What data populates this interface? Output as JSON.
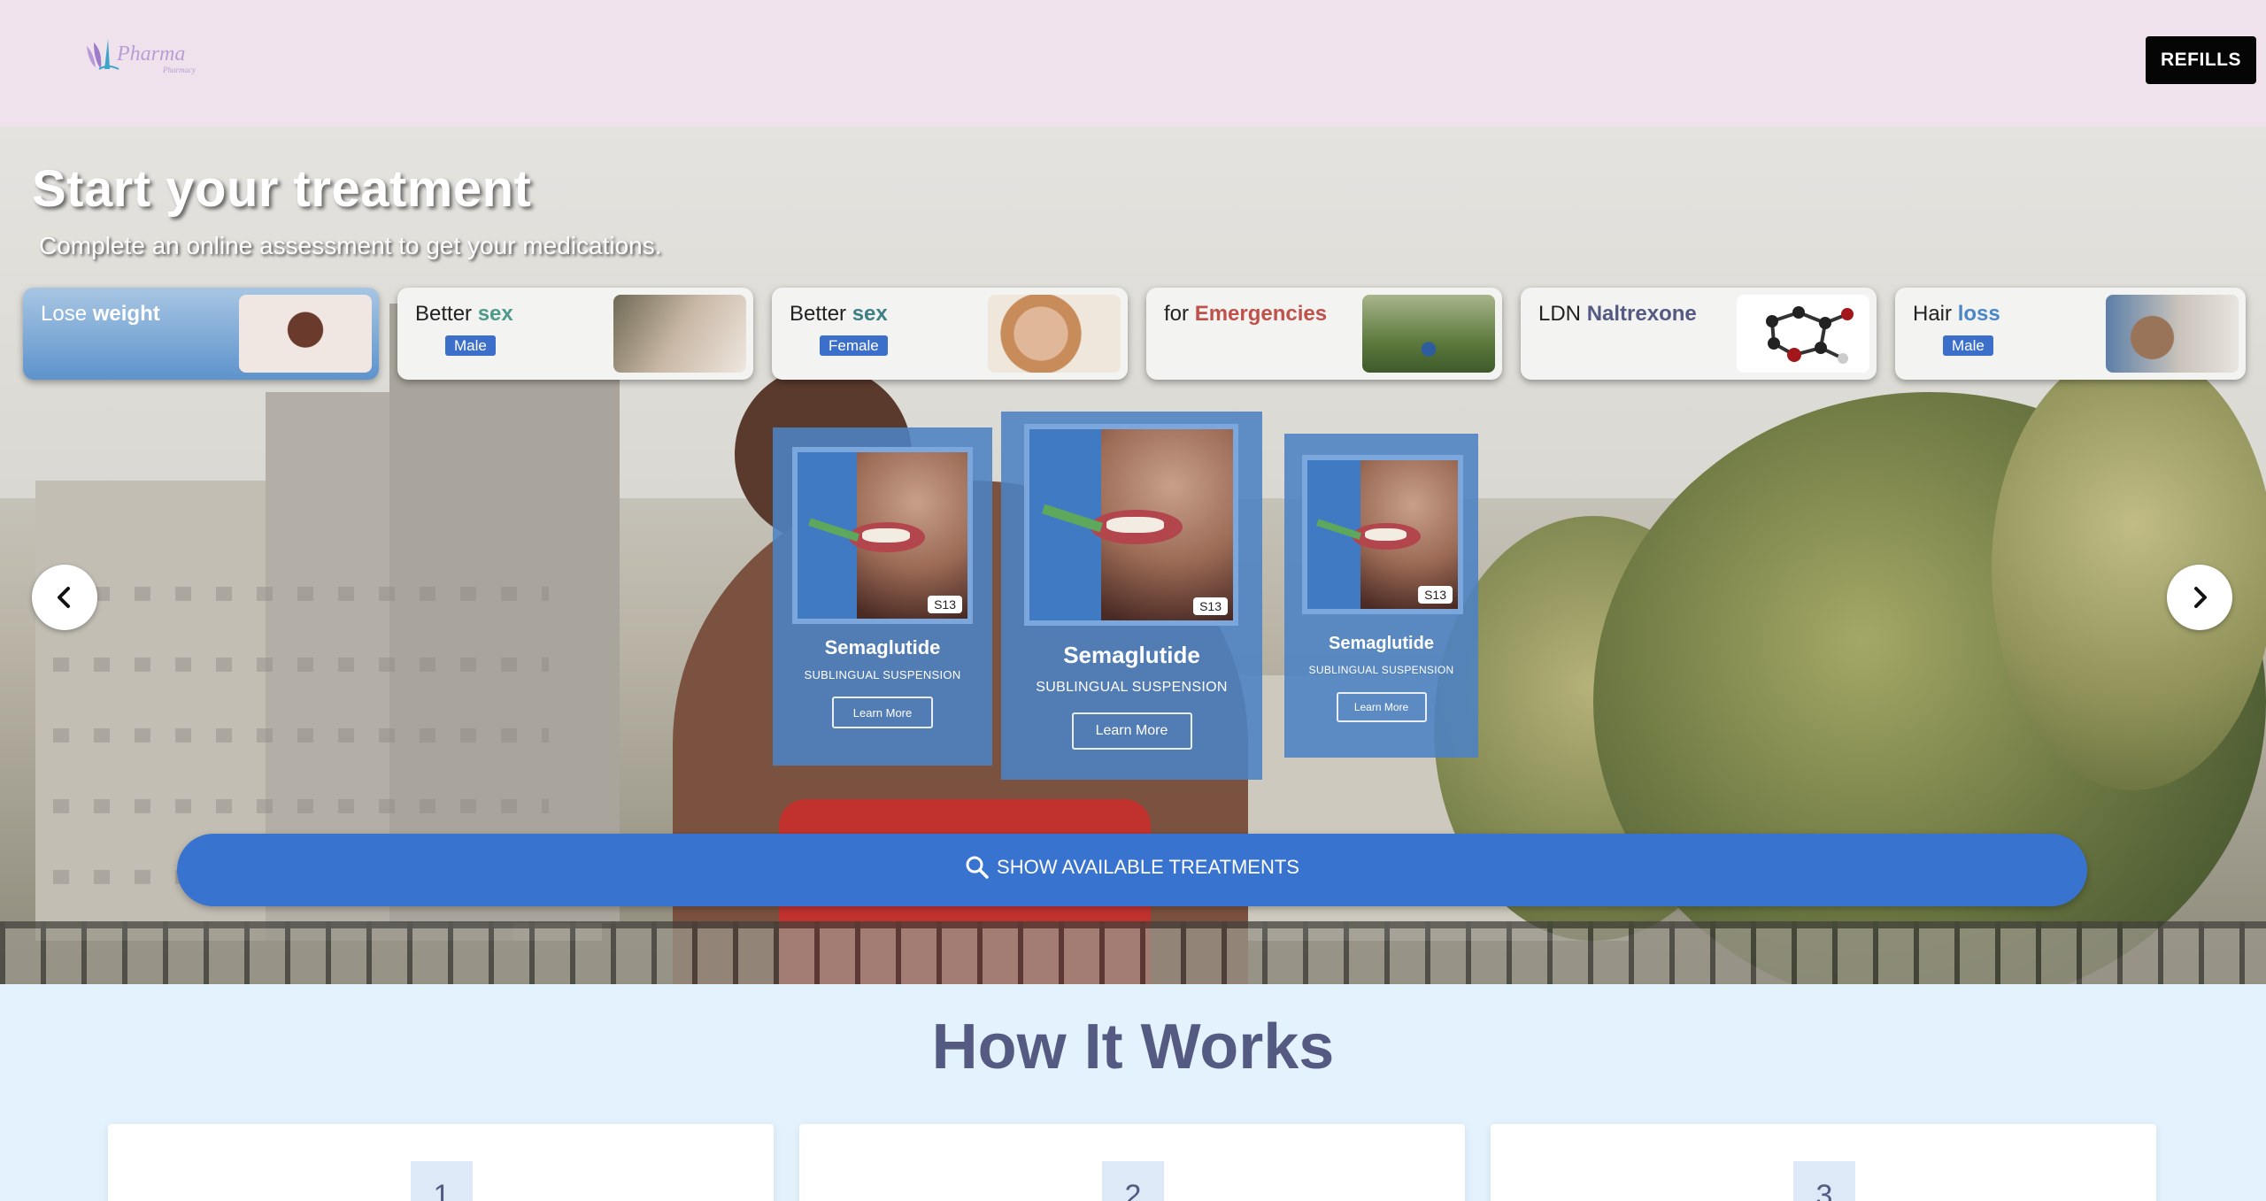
{
  "header": {
    "logo_text": "Pharma",
    "logo_subtext": "Pharmacy",
    "refills_label": "REFILLS"
  },
  "hero": {
    "title": "Start your treatment",
    "subtitle": "Complete an online assessment to get your medications.",
    "categories": [
      {
        "prefix": "Lose",
        "highlight": "weight",
        "highlight_color": "#ffffff",
        "badge": ""
      },
      {
        "prefix": "Better",
        "highlight": "sex",
        "highlight_color": "#4f9a8a",
        "badge": "Male"
      },
      {
        "prefix": "Better",
        "highlight": "sex",
        "highlight_color": "#3e7f86",
        "badge": "Female"
      },
      {
        "prefix": "for",
        "highlight": "Emergencies",
        "highlight_color": "#c0504a",
        "badge": ""
      },
      {
        "prefix": "LDN",
        "highlight": "Naltrexone",
        "highlight_color": "#545a82",
        "badge": ""
      },
      {
        "prefix": "Hair",
        "highlight": "loss",
        "highlight_color": "#4a87c8",
        "badge": "Male"
      }
    ],
    "products": [
      {
        "name": "Semaglutide",
        "kind": "SUBLINGUAL SUSPENSION",
        "tag": "S13",
        "button": "Learn More"
      },
      {
        "name": "Semaglutide",
        "kind": "SUBLINGUAL SUSPENSION",
        "tag": "S13",
        "button": "Learn More"
      },
      {
        "name": "Semaglutide",
        "kind": "SUBLINGUAL SUSPENSION",
        "tag": "S13",
        "button": "Learn More"
      }
    ],
    "show_button_label": "SHOW AVAILABLE TREATMENTS"
  },
  "how": {
    "title": "How It Works",
    "steps": [
      "1",
      "2",
      "3"
    ]
  },
  "colors": {
    "accent": "#3874cf",
    "header_bg": "#efe2ec",
    "section_bg": "#e3f2fc",
    "title_color": "#545a82"
  },
  "icons": {
    "prev": "chevron-left-icon",
    "next": "chevron-right-icon",
    "search": "search-icon"
  }
}
